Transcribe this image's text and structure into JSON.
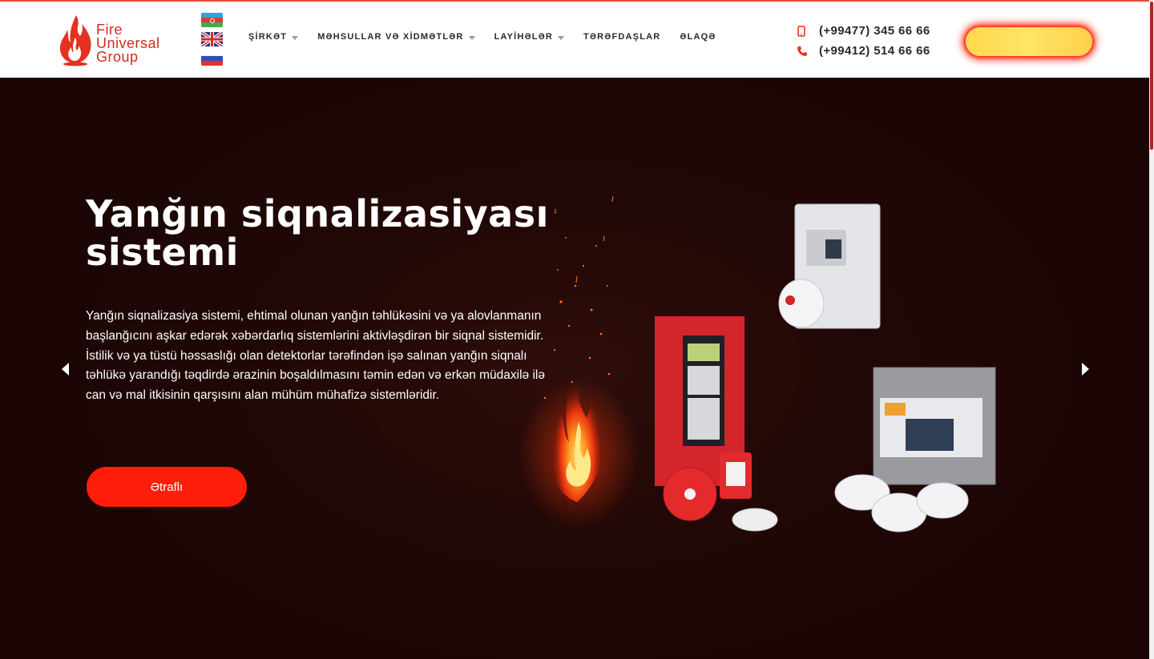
{
  "brand": {
    "logo_line1": "Fire",
    "logo_line2": "Universal",
    "logo_line3": "Group",
    "accent_color": "#ff1e0a",
    "logo_icon": "flame-icon"
  },
  "languages": [
    {
      "icon": "flag-azerbaijan-icon"
    },
    {
      "icon": "flag-uk-icon"
    },
    {
      "icon": "flag-russia-icon"
    }
  ],
  "nav": {
    "items": [
      {
        "label": "ŞİRKƏT",
        "has_dropdown": true
      },
      {
        "label": "MƏHSULLAR VƏ XİDMƏTLƏR",
        "has_dropdown": true
      },
      {
        "label": "LAYİHƏLƏR",
        "has_dropdown": true
      },
      {
        "label": "TƏRƏFDAŞLAR",
        "has_dropdown": false
      },
      {
        "label": "ƏLAQƏ",
        "has_dropdown": false
      }
    ]
  },
  "contact": {
    "mobile": "(+99477) 345 66 66",
    "phone": "(+99412) 514 66 66"
  },
  "hero": {
    "title": "Yanğın siqnalizasiyası sistemi",
    "description": "Yanğın siqnalizasiya sistemi, ehtimal olunan yanğın təhlükəsini və ya alovlanmanın başlanğıcını aşkar edərək xəbərdarlıq sistemlərini aktivləşdirən bir siqnal sistemidir. İstilik və ya tüstü həssaslığı olan detektorlar tərəfindən işə salınan yanğın siqnalı təhlükə yarandığı təqdirdə ərazinin boşaldılmasını təmin edən və erkən müdaxilə ilə can və mal itkisinin qarşısını alan mühüm mühafizə sistemləridir.",
    "button_label": "Ətraflı",
    "background_color": "#1f0706"
  }
}
